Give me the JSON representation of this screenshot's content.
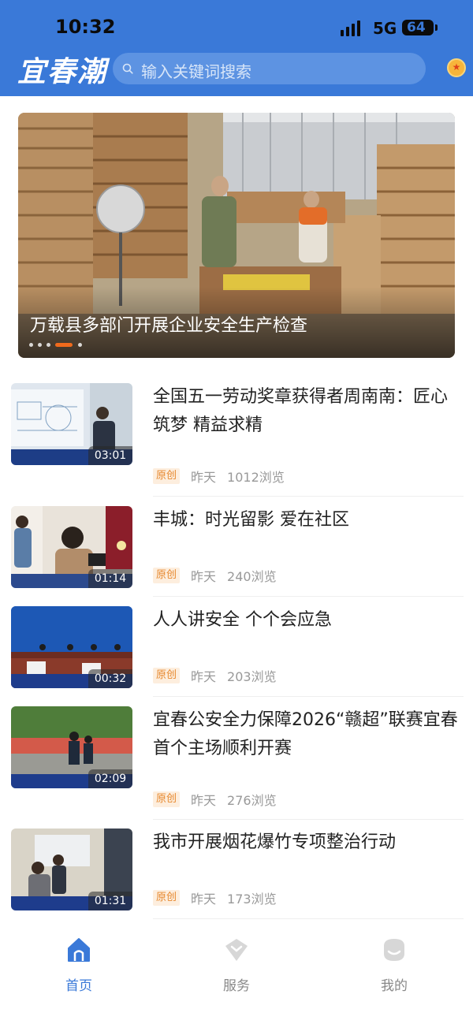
{
  "status_bar": {
    "time": "10:32",
    "network": "5G",
    "battery": "64"
  },
  "header": {
    "logo": "宜春潮",
    "search_placeholder": "输入关键词搜索"
  },
  "banner": {
    "title": "万载县多部门开展企业安全生产检查",
    "slide_count": 5,
    "active_slide": 4
  },
  "news": [
    {
      "title": "全国五一劳动奖章获得者周南南：匠心筑梦  精益求精",
      "duration": "03:01",
      "tag": "原创",
      "time": "昨天",
      "views": "1012浏览"
    },
    {
      "title": "丰城：时光留影  爱在社区",
      "duration": "01:14",
      "tag": "原创",
      "time": "昨天",
      "views": "240浏览"
    },
    {
      "title": "人人讲安全  个个会应急",
      "duration": "00:32",
      "tag": "原创",
      "time": "昨天",
      "views": "203浏览"
    },
    {
      "title": "宜春公安全力保障2026“赣超”联赛宜春首个主场顺利开赛",
      "duration": "02:09",
      "tag": "原创",
      "time": "昨天",
      "views": "276浏览"
    },
    {
      "title": "我市开展烟花爆竹专项整治行动",
      "duration": "01:31",
      "tag": "原创",
      "time": "昨天",
      "views": "173浏览"
    }
  ],
  "tabbar": {
    "tabs": [
      {
        "label": "首页",
        "icon": "home-icon",
        "active": true
      },
      {
        "label": "服务",
        "icon": "service-icon",
        "active": false
      },
      {
        "label": "我的",
        "icon": "profile-icon",
        "active": false
      }
    ]
  },
  "colors": {
    "brand": "#3a79d8",
    "tag_text": "#e7892f",
    "tag_bg": "#fdeede",
    "active_dot": "#f06a1c"
  }
}
